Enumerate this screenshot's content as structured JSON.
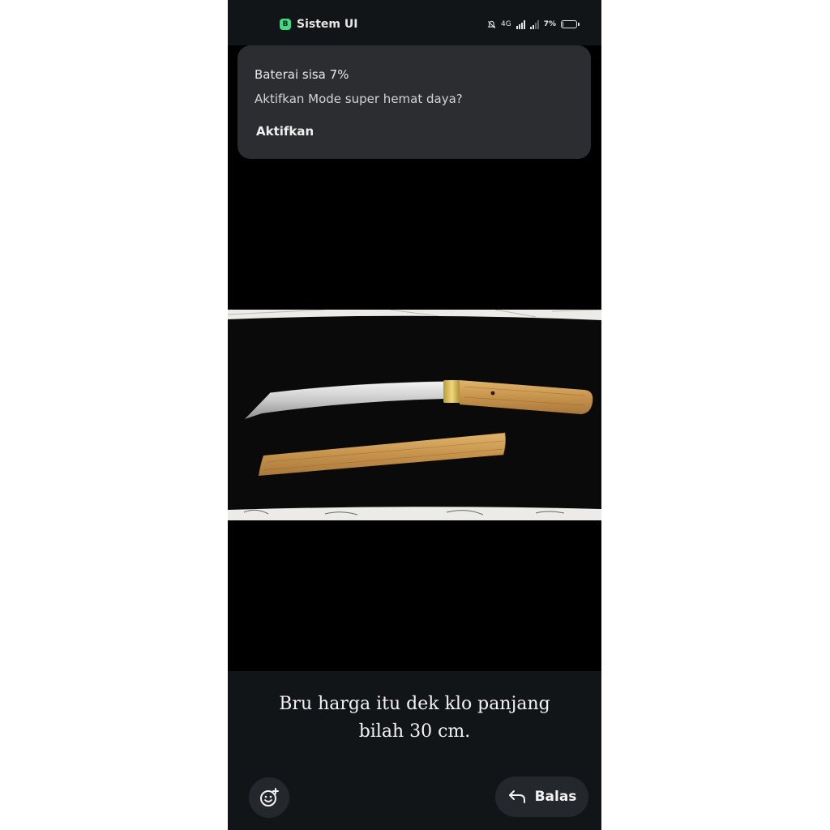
{
  "status_bar": {
    "app_icon": "B",
    "app_name": "Sistem UI",
    "network": "4G",
    "battery_text": "7%",
    "battery_level": 0.07,
    "icons": [
      "mute-bell-icon",
      "signal-icon",
      "battery-icon"
    ]
  },
  "notification": {
    "title": "Baterai sisa 7%",
    "body": "Aktifkan Mode super hemat daya?",
    "action_label": "Aktifkan"
  },
  "message": {
    "caption": "Bru harga itu dek klo panjang bilah 30 cm."
  },
  "footer": {
    "emoji_icon": "emoji-add-icon",
    "reply_icon": "reply-arrow-icon",
    "reply_label": "Balas"
  },
  "colors": {
    "background": "#000000",
    "panel": "#121518",
    "notification_bg": "#2b2d30",
    "button_bg": "#24282c",
    "text": "#f2f2f2"
  }
}
